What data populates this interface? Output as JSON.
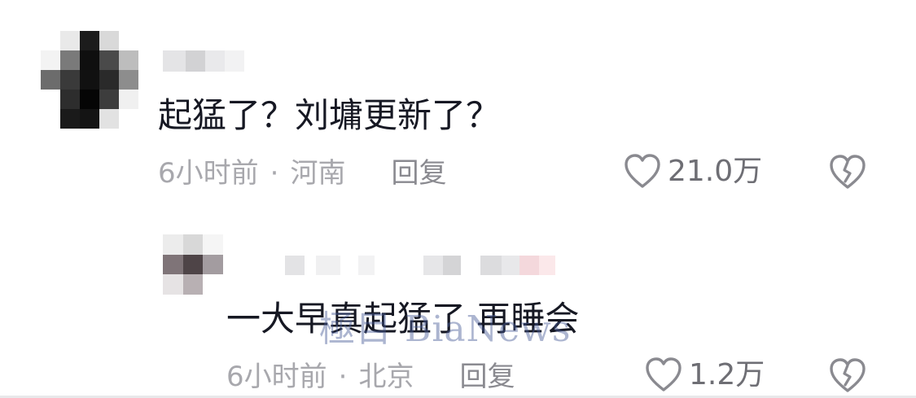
{
  "comments": [
    {
      "text": "起猛了？刘墉更新了？",
      "time": "6小时前",
      "separator": "·",
      "location": "河南",
      "reply_label": "回复",
      "likes": "21.0万"
    },
    {
      "text": "一大早真起猛了 再睡会",
      "time": "6小时前",
      "separator": "·",
      "location": "北京",
      "reply_label": "回复",
      "likes": "1.2万"
    }
  ],
  "watermark": "極目 BiaNews",
  "icons": {
    "like": "heart-outline-icon",
    "dislike": "broken-heart-icon"
  },
  "colors": {
    "text": "#161823",
    "meta": "#a8a8ad",
    "icon": "#8a8a90"
  }
}
